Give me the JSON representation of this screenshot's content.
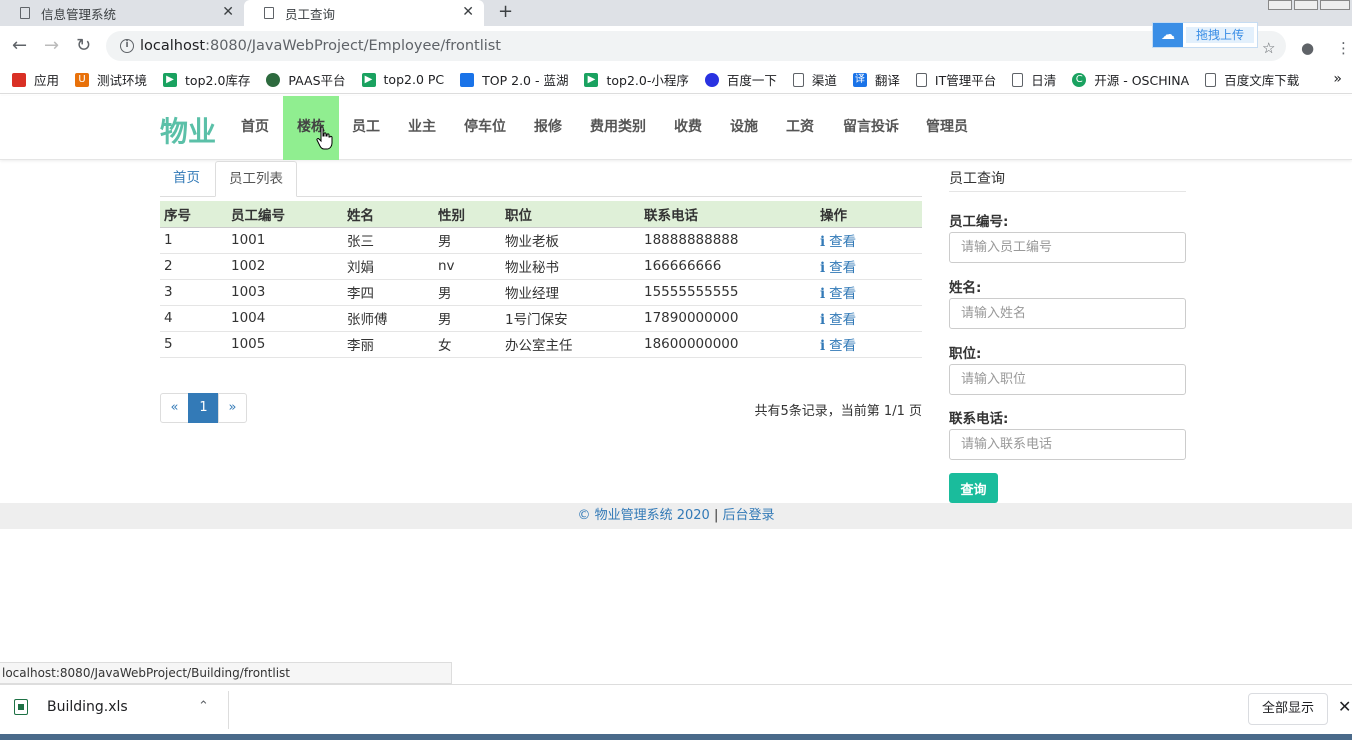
{
  "browser": {
    "tabs": [
      {
        "title": "信息管理系统",
        "close": "✕"
      },
      {
        "title": "员工查询",
        "close": "✕"
      }
    ],
    "new_tab": "+",
    "url_host": "localhost",
    "url_path": ":8080/JavaWebProject/Employee/frontlist",
    "cloud_upload": "拖拽上传",
    "bookmarks": [
      "应用",
      "测试环境",
      "top2.0库存",
      "PAAS平台",
      "top2.0 PC",
      "TOP 2.0 - 蓝湖",
      "top2.0-小程序",
      "百度一下",
      "渠道",
      "翻译",
      "IT管理平台",
      "日清",
      "开源 - OSCHINA",
      "百度文库下载"
    ],
    "bookmarks_more": "»"
  },
  "site": {
    "brand": "物业",
    "nav": [
      "首页",
      "楼栋",
      "员工",
      "业主",
      "停车位",
      "报修",
      "费用类别",
      "收费",
      "设施",
      "工资",
      "留言投诉",
      "管理员"
    ],
    "hover_color": "#90ee90",
    "brand_color": "#5bc0a8"
  },
  "breadcrumb": {
    "home": "首页",
    "current": "员工列表"
  },
  "table": {
    "headers": [
      "序号",
      "员工编号",
      "姓名",
      "性别",
      "职位",
      "联系电话",
      "操作"
    ],
    "rows": [
      [
        "1",
        "1001",
        "张三",
        "男",
        "物业老板",
        "18888888888",
        "查看"
      ],
      [
        "2",
        "1002",
        "刘娟",
        "nv",
        "物业秘书",
        "166666666",
        "查看"
      ],
      [
        "3",
        "1003",
        "李四",
        "男",
        "物业经理",
        "15555555555",
        "查看"
      ],
      [
        "4",
        "1004",
        "张师傅",
        "男",
        "1号门保安",
        "17890000000",
        "查看"
      ],
      [
        "5",
        "1005",
        "李丽",
        "女",
        "办公室主任",
        "18600000000",
        "查看"
      ]
    ],
    "action_icon": "info-icon"
  },
  "pager": {
    "prev": "«",
    "current": "1",
    "next": "»",
    "summary": "共有5条记录，当前第 1/1 页"
  },
  "search": {
    "title": "员工查询",
    "fields": [
      {
        "label": "员工编号:",
        "placeholder": "请输入员工编号"
      },
      {
        "label": "姓名:",
        "placeholder": "请输入姓名"
      },
      {
        "label": "职位:",
        "placeholder": "请输入职位"
      },
      {
        "label": "联系电话:",
        "placeholder": "请输入联系电话"
      }
    ],
    "button": "查询",
    "button_color": "#1abc9c"
  },
  "footer": {
    "copyright": "© 物业管理系统 2020",
    "separator": " | ",
    "admin_login": "后台登录"
  },
  "status_url": "localhost:8080/JavaWebProject/Building/frontlist",
  "downloads": {
    "file": "Building.xls",
    "show_all": "全部显示",
    "close": "✕"
  }
}
